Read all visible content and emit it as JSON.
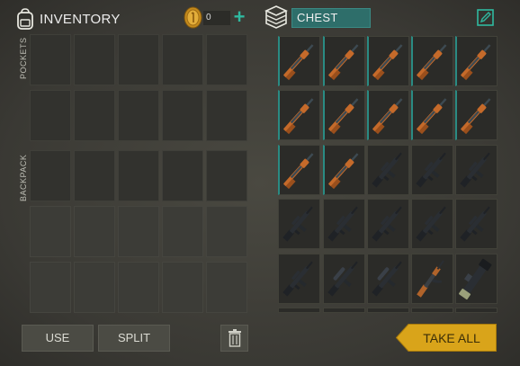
{
  "inventory": {
    "title": "INVENTORY",
    "pockets_label": "POCKETS",
    "backpack_label": "BACKPACK"
  },
  "currency": {
    "count": "0",
    "add_label": "+"
  },
  "chest": {
    "name": "CHEST"
  },
  "buttons": {
    "use": "USE",
    "split": "SPLIT",
    "take_all": "TAKE ALL"
  },
  "chest_items": [
    "shotgun",
    "shotgun",
    "shotgun",
    "shotgun",
    "shotgun",
    "shotgun",
    "shotgun",
    "shotgun",
    "shotgun",
    "shotgun",
    "shotgun",
    "shotgun",
    "assault-rifle",
    "assault-rifle",
    "assault-rifle",
    "assault-rifle",
    "assault-rifle",
    "assault-rifle",
    "assault-rifle",
    "assault-rifle",
    "assault-rifle",
    "scoped-rifle",
    "scoped-rifle",
    "ak-rifle",
    "rocket-launcher"
  ],
  "colors": {
    "accent": "#2fb9a0",
    "chest_field": "#2e6e6a",
    "take_all": "#d9a41a",
    "take_all_text": "#3b2e08"
  }
}
